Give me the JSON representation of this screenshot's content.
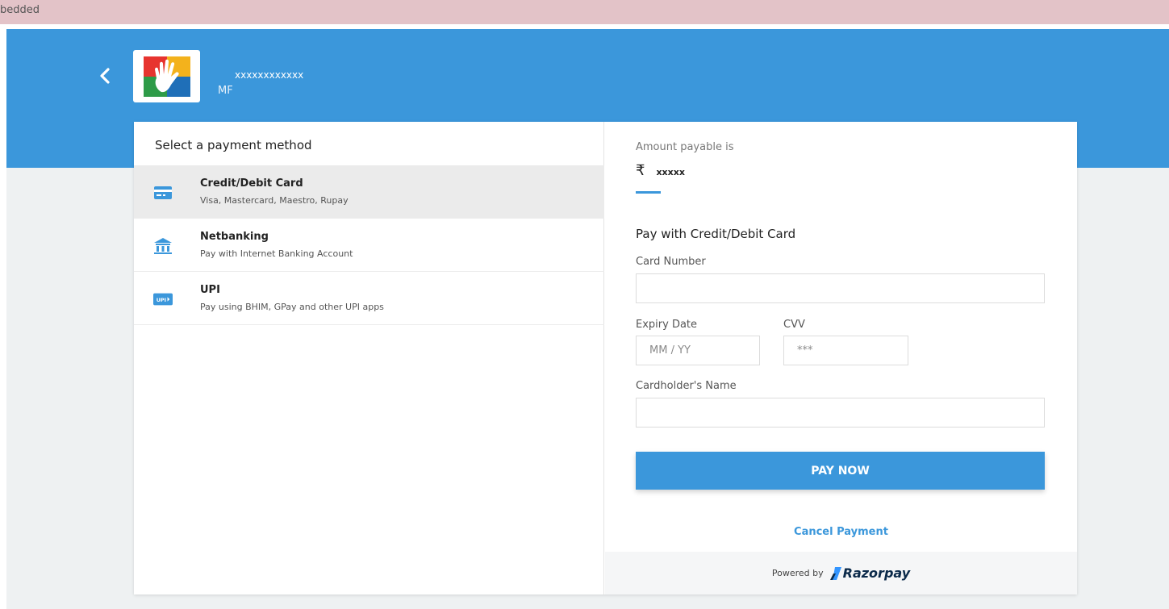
{
  "browser": {
    "embedded_label": "bedded"
  },
  "header": {
    "merchant_name": "xxxxxxxxxxxx",
    "merchant_sub": "MF"
  },
  "methods": {
    "title": "Select a payment method",
    "items": [
      {
        "name": "Credit/Debit Card",
        "desc": "Visa, Mastercard, Maestro, Rupay",
        "icon": "credit-card-icon",
        "active": true
      },
      {
        "name": "Netbanking",
        "desc": "Pay with Internet Banking Account",
        "icon": "bank-icon",
        "active": false
      },
      {
        "name": "UPI",
        "desc": "Pay using BHIM, GPay and other UPI apps",
        "icon": "upi-icon",
        "active": false
      }
    ]
  },
  "amount": {
    "label": "Amount payable is",
    "symbol": "₹",
    "value": "xxxxx"
  },
  "form": {
    "title": "Pay with Credit/Debit Card",
    "card_number_label": "Card Number",
    "card_number_value": "",
    "expiry_label": "Expiry Date",
    "expiry_placeholder": "MM / YY",
    "cvv_label": "CVV",
    "cvv_placeholder": "***",
    "name_label": "Cardholder's Name",
    "name_value": "",
    "pay_button": "PAY NOW",
    "cancel": "Cancel Payment"
  },
  "footer": {
    "powered_by": "Powered by",
    "brand": "Razorpay"
  },
  "colors": {
    "primary": "#3b97db",
    "background": "#eef1f2",
    "active_row": "#ebebeb",
    "top_strip": "#e3c3c8"
  }
}
